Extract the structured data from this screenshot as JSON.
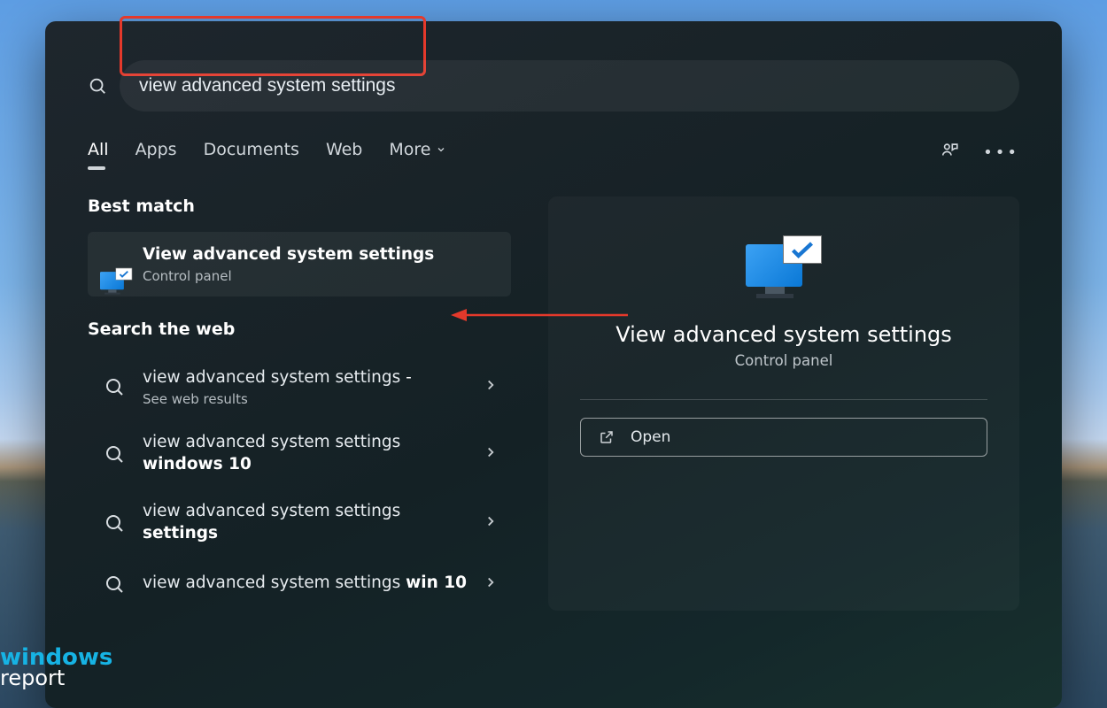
{
  "search": {
    "query": "view advanced system settings"
  },
  "filters": {
    "all": "All",
    "apps": "Apps",
    "documents": "Documents",
    "web": "Web",
    "more": "More"
  },
  "sections": {
    "best_match": "Best match",
    "search_web": "Search the web"
  },
  "best_match": {
    "title": "View advanced system settings",
    "subtitle": "Control panel"
  },
  "web_results": [
    {
      "prefix": "view advanced system settings",
      "suffix": " - ",
      "sub": "See web results"
    },
    {
      "prefix": "view advanced system settings ",
      "bold": "windows 10"
    },
    {
      "prefix": "view advanced system settings ",
      "bold": "settings"
    },
    {
      "prefix": "view advanced system settings ",
      "bold": "win 10"
    }
  ],
  "preview": {
    "title": "View advanced system settings",
    "subtitle": "Control panel",
    "open": "Open"
  },
  "watermark": {
    "line1": "windows",
    "line2": "report"
  }
}
